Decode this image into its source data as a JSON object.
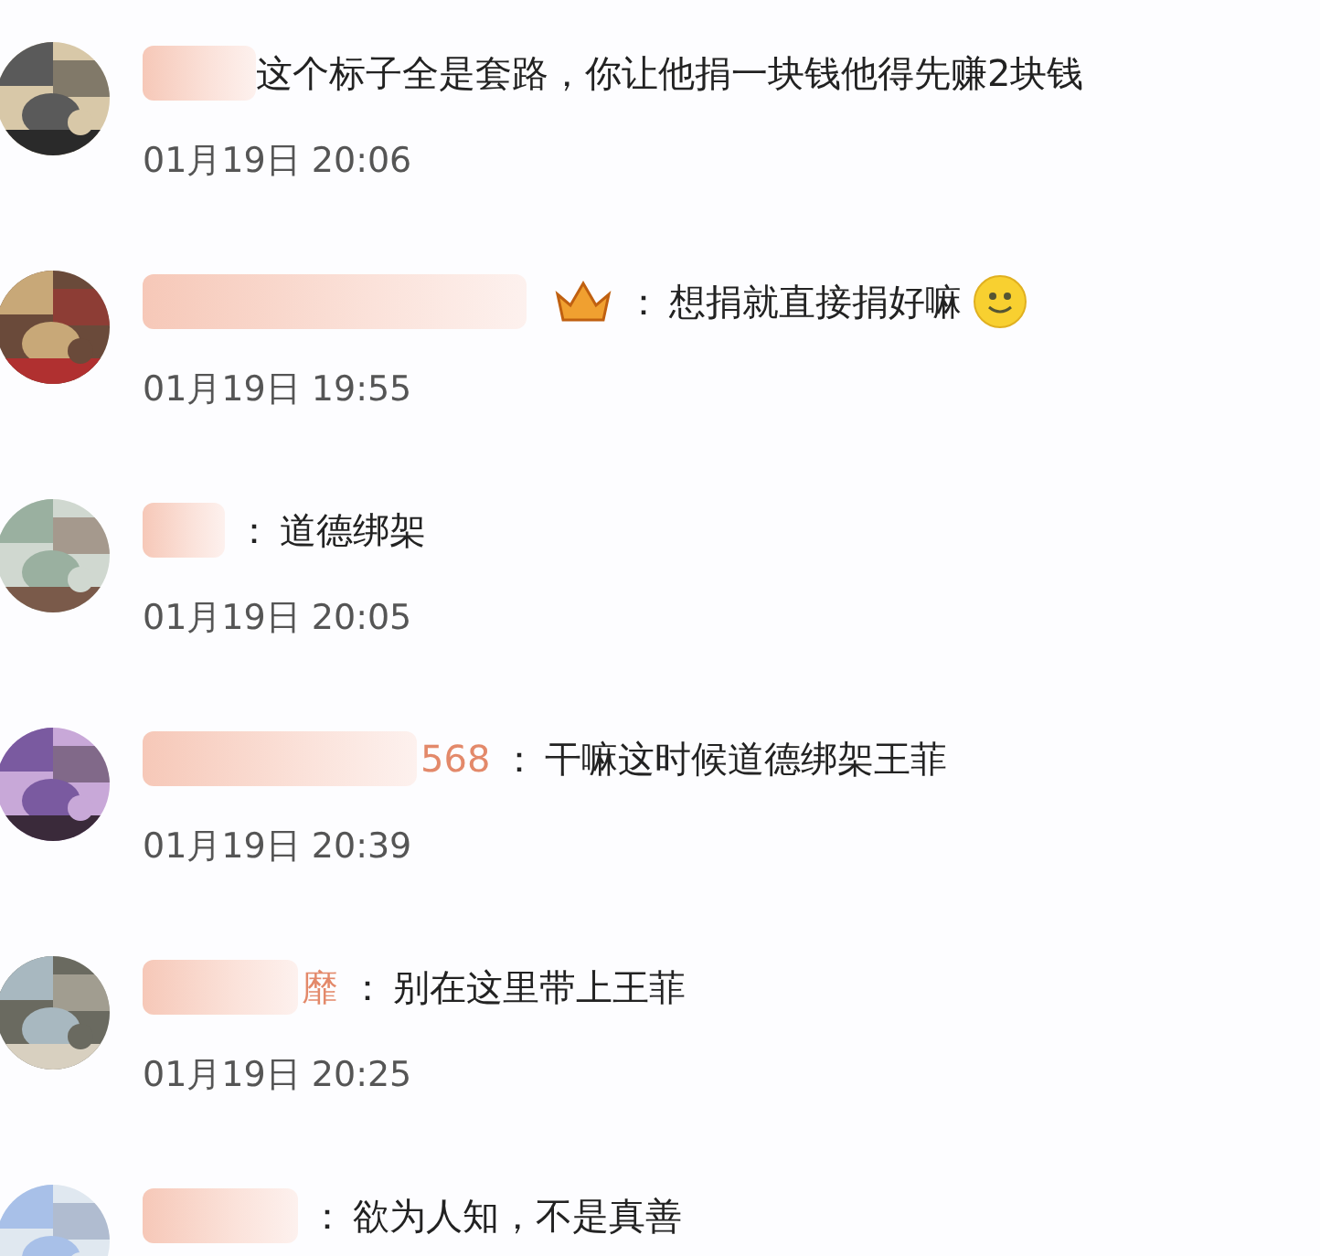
{
  "comments": [
    {
      "has_badge": false,
      "text": "这个标子全是套路，你让他捐一块钱他得先赚2块钱",
      "has_emoji": false,
      "time": "01月19日 20:06"
    },
    {
      "has_badge": true,
      "separator": "：",
      "text": "想捐就直接捐好嘛",
      "has_emoji": true,
      "time": "01月19日 19:55"
    },
    {
      "has_badge": false,
      "separator": "：",
      "text": "道德绑架",
      "has_emoji": false,
      "time": "01月19日 20:05"
    },
    {
      "name_fragment": "568",
      "has_badge": false,
      "separator": "：",
      "text": "干嘛这时候道德绑架王菲",
      "has_emoji": false,
      "time": "01月19日 20:39"
    },
    {
      "name_fragment": "靡",
      "has_badge": false,
      "separator": "：",
      "text": "别在这里带上王菲",
      "has_emoji": false,
      "time": "01月19日 20:25"
    },
    {
      "has_badge": false,
      "separator": "：",
      "text": "欲为人知，不是真善",
      "has_emoji": false
    }
  ]
}
